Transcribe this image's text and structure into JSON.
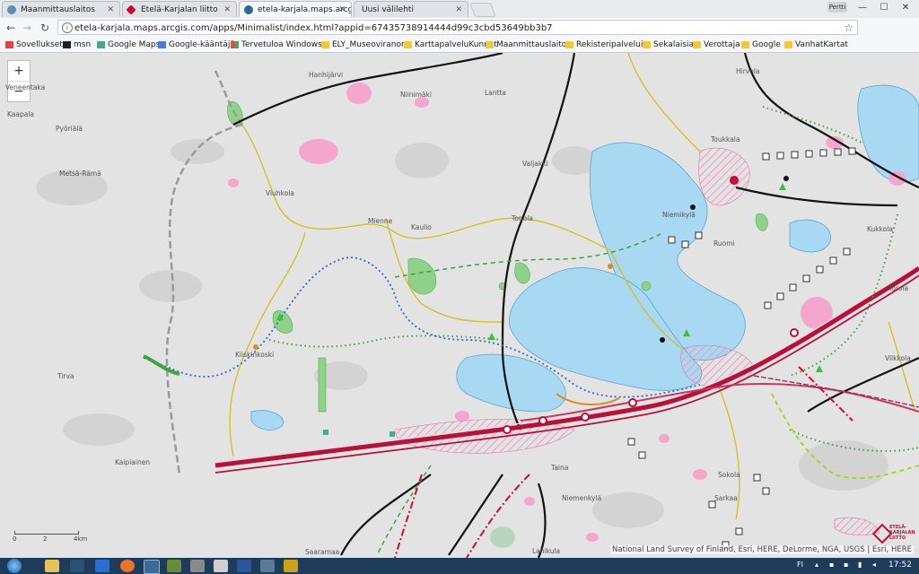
{
  "tabs": [
    {
      "label": "Maanmittauslaitos",
      "color": "#5b8db8"
    },
    {
      "label": "Etelä-Karjalan liitto",
      "color": "#c8102e"
    },
    {
      "label": "etela-karjala.maps.arcgis.",
      "color": "#2d6a8f"
    },
    {
      "label": "Uusi välilehti",
      "color": ""
    }
  ],
  "window_user": "Pertti",
  "address": {
    "url": "etela-karjala.maps.arcgis.com/apps/Minimalist/index.html?appid=67435738914444d99c3cbd53649bb3b7"
  },
  "bookmarks": [
    {
      "label": "Sovellukset",
      "icon": "apps-icon",
      "color": "#d44"
    },
    {
      "label": "msn",
      "icon": "msn-icon",
      "color": "#222"
    },
    {
      "label": "Google Maps",
      "icon": "maps-icon",
      "color": "#4a8"
    },
    {
      "label": "Google-kääntäjä",
      "icon": "translate-icon",
      "color": "#4a7bd6"
    },
    {
      "label": "Tervetuloa Windows",
      "icon": "windows-icon",
      "color": "#e44"
    },
    {
      "label": "ELY_Museoviranom",
      "icon": "folder-icon",
      "color": "#f4c542"
    },
    {
      "label": "KarttapalveluKunnat",
      "icon": "folder-icon",
      "color": "#f4c542"
    },
    {
      "label": "Maanmittauslaitos",
      "icon": "folder-icon",
      "color": "#f4c542"
    },
    {
      "label": "Rekisteripalveluita",
      "icon": "folder-icon",
      "color": "#f4c542"
    },
    {
      "label": "Sekalaisia",
      "icon": "folder-icon",
      "color": "#f4c542"
    },
    {
      "label": "Verottaja",
      "icon": "folder-icon",
      "color": "#f4c542"
    },
    {
      "label": "Google",
      "icon": "folder-icon",
      "color": "#f4c542"
    },
    {
      "label": "VanhatKartat",
      "icon": "folder-icon",
      "color": "#f4c542"
    }
  ],
  "map": {
    "zoom_in": "+",
    "zoom_out": "−",
    "places": [
      {
        "name": "Veneentaka"
      },
      {
        "name": "Kaapala"
      },
      {
        "name": "Pyöriälä"
      },
      {
        "name": "Metsä-Rämä"
      },
      {
        "name": "Hanhijärvi"
      },
      {
        "name": "Niinimäki"
      },
      {
        "name": "Lantta"
      },
      {
        "name": "Viuhkola"
      },
      {
        "name": "Mienne"
      },
      {
        "name": "Kaulio"
      },
      {
        "name": "Valjakki"
      },
      {
        "name": "Tonola"
      },
      {
        "name": "Ruomi"
      },
      {
        "name": "Niemikylä"
      },
      {
        "name": "Kukkola"
      },
      {
        "name": "Torola"
      },
      {
        "name": "Tirva"
      },
      {
        "name": "Kaipiainen"
      },
      {
        "name": "Kiiskinkoski"
      },
      {
        "name": "Taina"
      },
      {
        "name": "Niemenkylä"
      },
      {
        "name": "Sokola"
      },
      {
        "name": "Saaramaa"
      },
      {
        "name": "Lahikula"
      },
      {
        "name": "Sarkaa"
      },
      {
        "name": "Toukkala"
      },
      {
        "name": "Hirvola"
      },
      {
        "name": "Vilkkola"
      }
    ],
    "scale": {
      "labels": [
        "0",
        "2",
        "4km"
      ]
    },
    "attribution": "National Land Survey of Finland, Esri, HERE, DeLorme, NGA, USGS | Esri, HERE",
    "logo_text": "ETELÄ-KARJALAN LIITTO",
    "colors": {
      "water": "#a9d8f2",
      "water_border": "#5aa5d6",
      "road_main": "#b3123a",
      "road_black": "#111111",
      "road_yellow": "#d4c028",
      "hatch_pink": "#f0a0c8",
      "green_zone": "#8fd18a",
      "dotted_green": "#3aa63a",
      "border_gray": "#8d8d8d"
    }
  },
  "taskbar": {
    "lang": "FI",
    "time": "17:52"
  }
}
